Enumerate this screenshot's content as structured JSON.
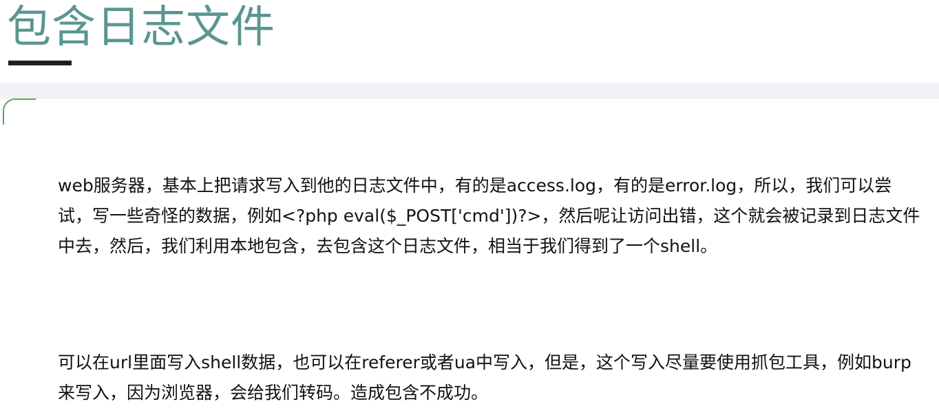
{
  "header": {
    "title": "包含日志文件"
  },
  "content": {
    "paragraphs": [
      "web服务器，基本上把请求写入到他的日志文件中，有的是access.log，有的是error.log，所以，我们可以尝试，写一些奇怪的数据，例如<?php eval($_POST['cmd'])?>，然后呢让访问出错，这个就会被记录到日志文件中去，然后，我们利用本地包含，去包含这个日志文件，相当于我们得到了一个shell。",
      "可以在url里面写入shell数据，也可以在referer或者ua中写入，但是，这个写入尽量要使用抓包工具，例如burp来写入，因为浏览器，会给我们转码。造成包含不成功。"
    ]
  },
  "colors": {
    "title": "#5a9690",
    "underline": "#1f1f1f",
    "band": "#f1f2f6",
    "accent": "#5aa35a",
    "text": "#111111"
  }
}
